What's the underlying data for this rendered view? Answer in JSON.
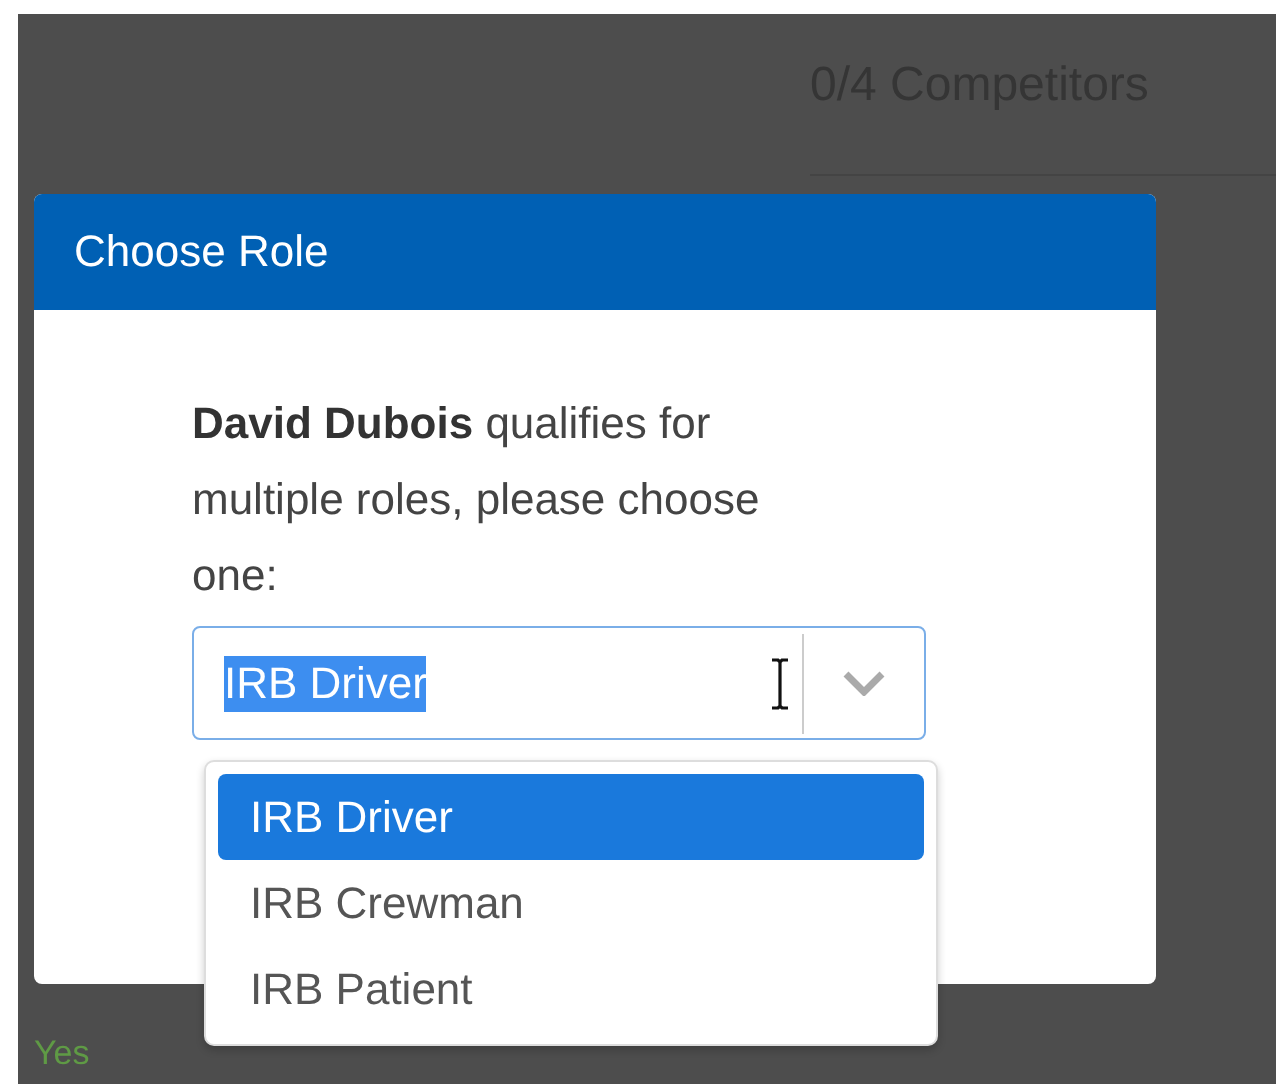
{
  "background": {
    "heading": "0/4 Competitors",
    "cell": "Yes"
  },
  "dialog": {
    "title": "Choose Role",
    "message": "**David Dubois** qualifies for multiple roles, please choose one:",
    "select": {
      "value": "IRB Driver",
      "text_highlighted": true,
      "expanded": true
    },
    "options": [
      {
        "label": "IRB Driver",
        "selected": true
      },
      {
        "label": "IRB Crewman",
        "selected": false
      },
      {
        "label": "IRB Patient",
        "selected": false
      }
    ]
  }
}
